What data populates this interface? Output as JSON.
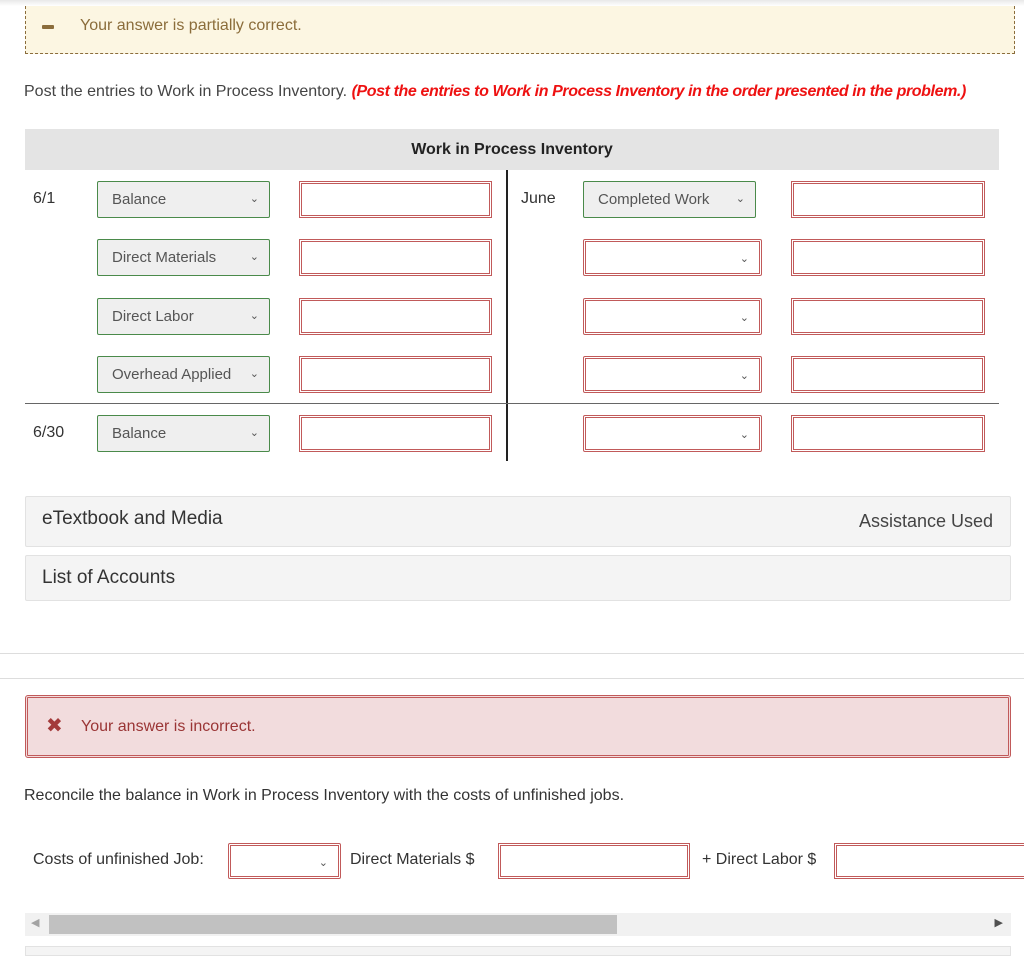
{
  "partial_alert": {
    "icon": "minus-icon",
    "text": "Your answer is partially correct."
  },
  "instructions": {
    "main": "Post the entries to Work in Process Inventory.",
    "note": "(Post the entries to Work in Process Inventory in the order presented in the problem.)"
  },
  "t_account": {
    "title": "Work in Process Inventory",
    "debit_rows": [
      {
        "date": "6/1",
        "account": "Balance",
        "amount": ""
      },
      {
        "date": "",
        "account": "Direct Materials",
        "amount": ""
      },
      {
        "date": "",
        "account": "Direct Labor",
        "amount": ""
      },
      {
        "date": "",
        "account": "Overhead Applied",
        "amount": ""
      }
    ],
    "ending_row": {
      "date": "6/30",
      "account": "Balance",
      "amount": ""
    },
    "credit_rows": [
      {
        "date": "June",
        "account": "Completed Work",
        "amount": ""
      },
      {
        "date": "",
        "account": "",
        "amount": ""
      },
      {
        "date": "",
        "account": "",
        "amount": ""
      },
      {
        "date": "",
        "account": "",
        "amount": ""
      }
    ],
    "credit_ending_row": {
      "date": "",
      "account": "",
      "amount": ""
    }
  },
  "panels": {
    "etextbook": "eTextbook and Media",
    "assistance": "Assistance Used",
    "accounts": "List of Accounts"
  },
  "incorrect_alert": {
    "icon": "x-icon",
    "text": "Your answer is incorrect."
  },
  "reconcile": {
    "instruction": "Reconcile the balance in Work in Process Inventory with the costs of unfinished jobs.",
    "job_label": "Costs of unfinished Job:",
    "job_value": "",
    "dm_label": "Direct Materials $",
    "dm_value": "",
    "dl_label": "+ Direct Labor $",
    "dl_value": ""
  },
  "colors": {
    "partial": "#8b6d3b",
    "incorrect": "#c15a5a",
    "instruction_note": "#ee1111",
    "correct_border": "#4a8a4a"
  }
}
